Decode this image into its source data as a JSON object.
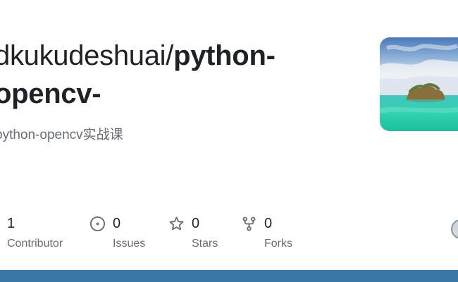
{
  "repo": {
    "owner": "dkukudeshuai/",
    "name_part1": "python-",
    "name_part2": "opencv-",
    "description": "python-opencv实战课"
  },
  "stats": [
    {
      "value": "1",
      "label": "Contributor",
      "icon": "people-icon"
    },
    {
      "value": "0",
      "label": "Issues",
      "icon": "issue-icon"
    },
    {
      "value": "0",
      "label": "Stars",
      "icon": "star-icon"
    },
    {
      "value": "0",
      "label": "Forks",
      "icon": "fork-icon"
    }
  ],
  "colors": {
    "text_primary": "#1f2328",
    "text_secondary": "#656d76",
    "bottom_bar": "#3a76a8"
  }
}
